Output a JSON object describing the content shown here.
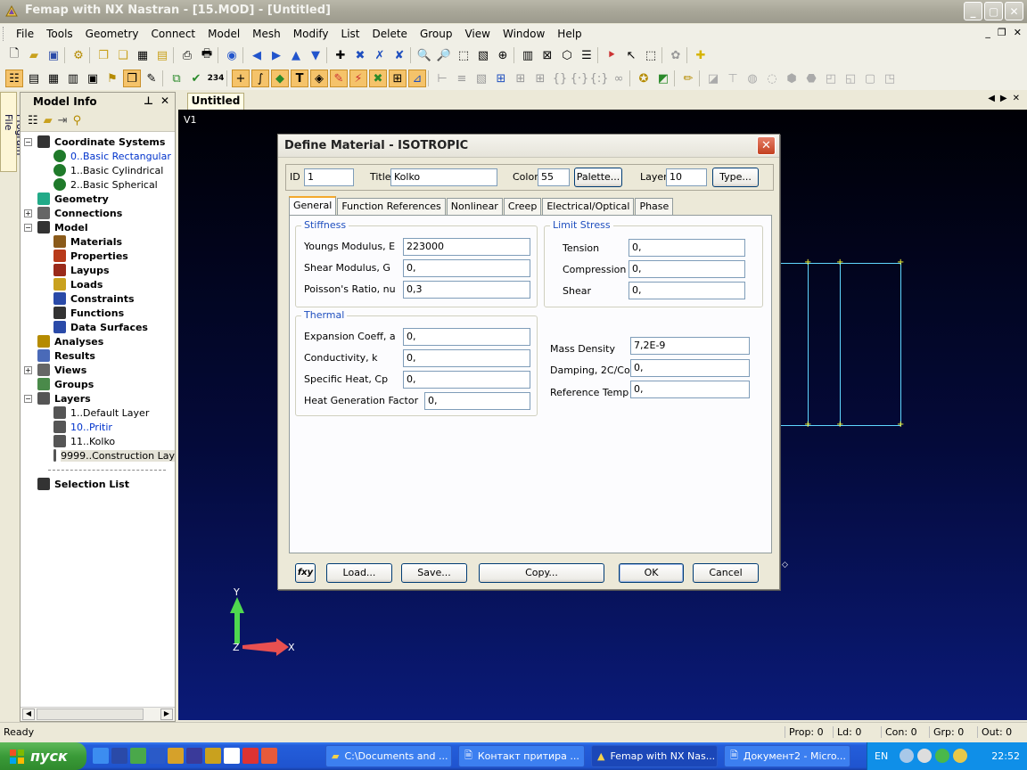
{
  "window": {
    "title": "Femap with NX Nastran - [15.MOD] - [Untitled]",
    "controls": [
      "_",
      "▢",
      "✕"
    ]
  },
  "menu": {
    "items": [
      "File",
      "Tools",
      "Geometry",
      "Connect",
      "Model",
      "Mesh",
      "Modify",
      "List",
      "Delete",
      "Group",
      "View",
      "Window",
      "Help"
    ],
    "mdi_controls": [
      "_",
      "❐",
      "✕"
    ]
  },
  "model_info": {
    "side_tab_label": "Program File",
    "title": "Model Info",
    "pin": "⊥",
    "close": "✕",
    "tree": [
      {
        "label": "Coordinate Systems",
        "style": "bold",
        "indent": 0,
        "expander": "−",
        "icon": "coordinate-systems-icon"
      },
      {
        "label": "0..Basic Rectangular",
        "style": "blue",
        "indent": 1,
        "icon": "globe-icon"
      },
      {
        "label": "1..Basic Cylindrical",
        "style": "norm",
        "indent": 1,
        "icon": "globe-icon"
      },
      {
        "label": "2..Basic Spherical",
        "style": "norm",
        "indent": 1,
        "icon": "globe-icon"
      },
      {
        "label": "Geometry",
        "style": "bold",
        "indent": 0,
        "icon": "geometry-icon"
      },
      {
        "label": "Connections",
        "style": "bold",
        "indent": 0,
        "expander": "+",
        "icon": "connections-icon"
      },
      {
        "label": "Model",
        "style": "bold",
        "indent": 0,
        "expander": "−",
        "icon": "model-grid-icon"
      },
      {
        "label": "Materials",
        "style": "bold",
        "indent": 1,
        "icon": "materials-icon"
      },
      {
        "label": "Properties",
        "style": "bold",
        "indent": 1,
        "icon": "properties-icon"
      },
      {
        "label": "Layups",
        "style": "bold",
        "indent": 1,
        "icon": "layups-icon"
      },
      {
        "label": "Loads",
        "style": "bold",
        "indent": 1,
        "icon": "loads-icon"
      },
      {
        "label": "Constraints",
        "style": "bold",
        "indent": 1,
        "icon": "constraints-icon"
      },
      {
        "label": "Functions",
        "style": "bold",
        "indent": 1,
        "icon": "functions-icon"
      },
      {
        "label": "Data Surfaces",
        "style": "bold",
        "indent": 1,
        "icon": "data-surfaces-icon"
      },
      {
        "label": "Analyses",
        "style": "bold",
        "indent": 0,
        "icon": "analyses-icon"
      },
      {
        "label": "Results",
        "style": "bold",
        "indent": 0,
        "icon": "results-icon"
      },
      {
        "label": "Views",
        "style": "bold",
        "indent": 0,
        "expander": "+",
        "icon": "views-icon"
      },
      {
        "label": "Groups",
        "style": "bold",
        "indent": 0,
        "icon": "groups-icon"
      },
      {
        "label": "Layers",
        "style": "bold",
        "indent": 0,
        "expander": "−",
        "icon": "layers-icon"
      },
      {
        "label": "1..Default Layer",
        "style": "norm",
        "indent": 1,
        "icon": "layer-icon"
      },
      {
        "label": "10..Pritir",
        "style": "blue",
        "indent": 1,
        "icon": "layer-icon"
      },
      {
        "label": "11..Kolko",
        "style": "norm",
        "indent": 1,
        "icon": "layer-icon"
      },
      {
        "label": "9999..Construction Lay",
        "style": "norm",
        "indent": 1,
        "icon": "layer-icon",
        "selected": true
      },
      {
        "label": "",
        "style": "norm",
        "indent": 0,
        "separator": true
      },
      {
        "label": "Selection List",
        "style": "bold",
        "indent": 0,
        "icon": "selection-list-icon"
      }
    ]
  },
  "document": {
    "tab_label": "Untitled",
    "view_label": "V1",
    "axis_y": "Y",
    "axis_x": "X",
    "axis_z": "Z"
  },
  "dialog": {
    "title": "Define Material - ISOTROPIC",
    "id_label": "ID",
    "id_value": "1",
    "title_label": "Title",
    "title_value": "Kolko",
    "color_label": "Color",
    "color_value": "55",
    "palette_button": "Palette...",
    "layer_label": "Layer",
    "layer_value": "10",
    "type_button": "Type...",
    "tabs": [
      "General",
      "Function References",
      "Nonlinear",
      "Creep",
      "Electrical/Optical",
      "Phase"
    ],
    "stiffness": {
      "title": "Stiffness",
      "youngs_label": "Youngs Modulus, E",
      "youngs_value": "223000",
      "shear_label": "Shear Modulus, G",
      "shear_value": "0,",
      "poisson_label": "Poisson's Ratio, nu",
      "poisson_value": "0,3"
    },
    "limit_stress": {
      "title": "Limit Stress",
      "tension_label": "Tension",
      "tension_value": "0,",
      "compression_label": "Compression",
      "compression_value": "0,",
      "shear_label": "Shear",
      "shear_value": "0,"
    },
    "thermal": {
      "title": "Thermal",
      "expansion_label": "Expansion Coeff, a",
      "expansion_value": "0,",
      "conductivity_label": "Conductivity, k",
      "conductivity_value": "0,",
      "specific_heat_label": "Specific Heat, Cp",
      "specific_heat_value": "0,",
      "heat_gen_label": "Heat Generation Factor",
      "heat_gen_value": "0,"
    },
    "other": {
      "mass_density_label": "Mass Density",
      "mass_density_value": "7,2E-9",
      "damping_label": "Damping, 2C/Co",
      "damping_value": "0,",
      "ref_temp_label": "Reference Temp",
      "ref_temp_value": "0,"
    },
    "buttons": {
      "fxy": "fxy",
      "load": "Load...",
      "save": "Save...",
      "copy": "Copy...",
      "ok": "OK",
      "cancel": "Cancel"
    }
  },
  "status": {
    "ready": "Ready",
    "prop": "Prop: 0",
    "ld": "Ld: 0",
    "con": "Con: 0",
    "grp": "Grp: 0",
    "out": "Out: 0"
  },
  "taskbar": {
    "start": "пуск",
    "tasks": [
      "C:\\Documents and ...",
      "Контакт притира ...",
      "Femap with NX Nas...",
      "Документ2 - Micro..."
    ],
    "lang": "EN",
    "clock": "22:52"
  },
  "colors": {
    "accent_orange": "#f4a92c",
    "group_title_blue": "#1f4fbf",
    "geometry_cyan": "#5fd6ff",
    "node_yellow": "#ffff33"
  }
}
